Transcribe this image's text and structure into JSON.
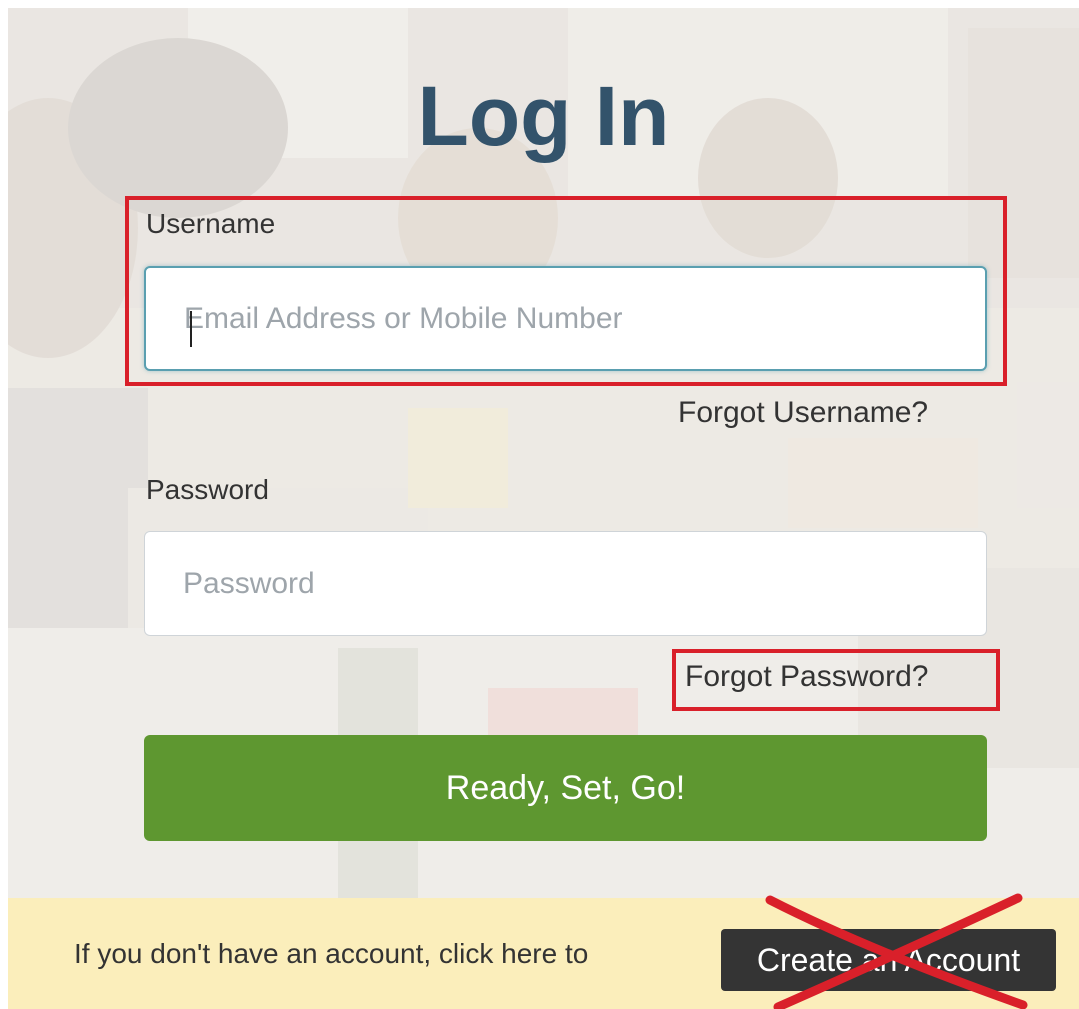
{
  "page": {
    "title": "Log In"
  },
  "username": {
    "label": "Username",
    "placeholder": "Email Address or Mobile Number",
    "forgot_link": "Forgot Username?"
  },
  "password": {
    "label": "Password",
    "placeholder": "Password",
    "forgot_link": "Forgot Password?"
  },
  "submit": {
    "label": "Ready, Set, Go!"
  },
  "footer": {
    "text": "If you don't have an account, click here to",
    "create_button": "Create an Account"
  },
  "colors": {
    "title": "#33536b",
    "submit_bg": "#5e9730",
    "footer_bg": "#fbeebb",
    "annotation_red": "#d9202a",
    "create_button_bg": "#343434"
  }
}
